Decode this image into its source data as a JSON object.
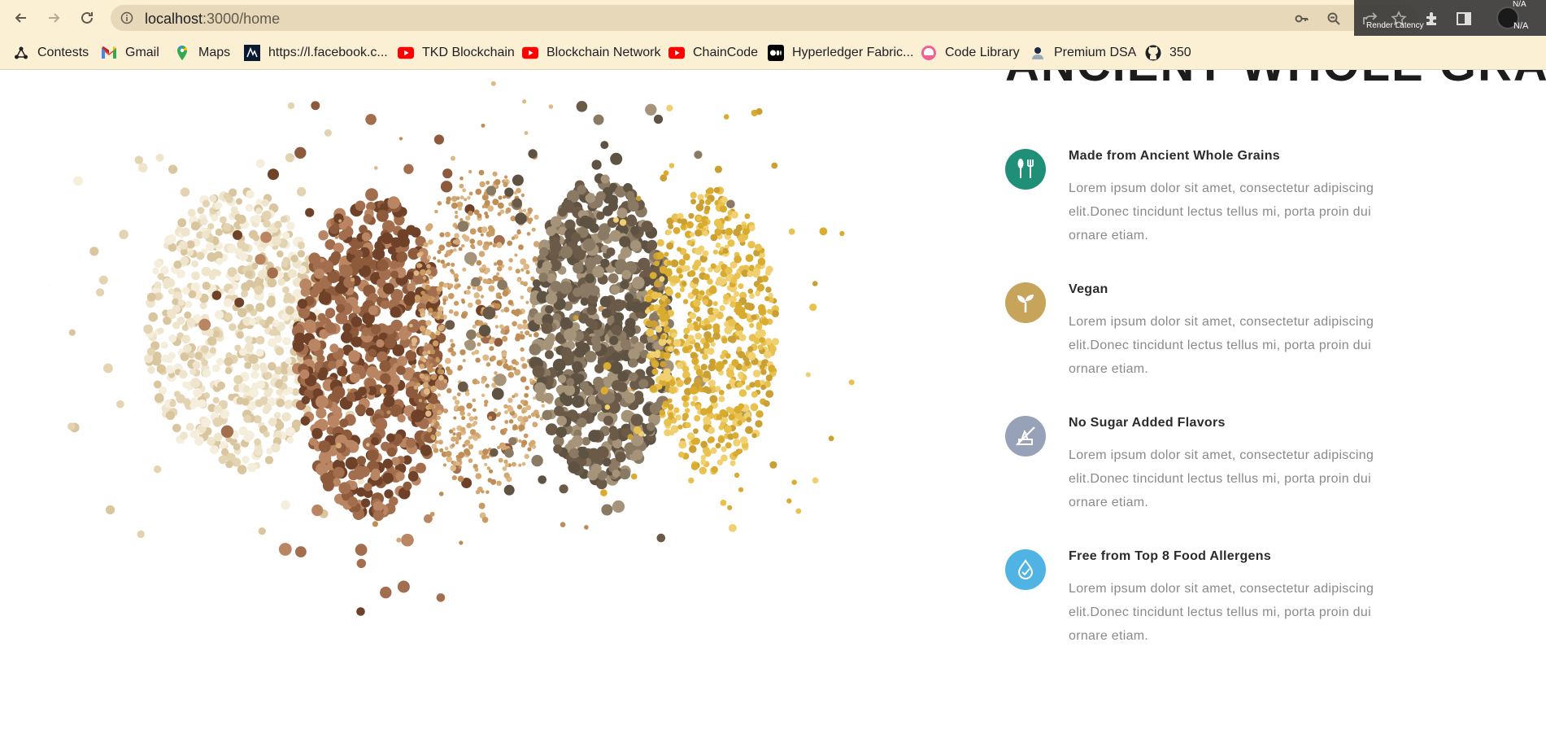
{
  "browser": {
    "url_host": "localhost",
    "url_path": ":3000/home",
    "render_latency": "Render Latency",
    "na_top": "N/A",
    "na_bottom": "N/A"
  },
  "bookmarks": [
    {
      "label": "Contests",
      "icon": "contests-icon"
    },
    {
      "label": "Gmail",
      "icon": "gmail-icon"
    },
    {
      "label": "Maps",
      "icon": "maps-icon"
    },
    {
      "label": "https://l.facebook.c...",
      "icon": "facebook-link-icon"
    },
    {
      "label": "TKD Blockchain",
      "icon": "youtube-icon"
    },
    {
      "label": "Blockchain Network",
      "icon": "youtube-icon"
    },
    {
      "label": "ChainCode",
      "icon": "youtube-icon"
    },
    {
      "label": "Hyperledger Fabric...",
      "icon": "medium-icon"
    },
    {
      "label": "Code Library",
      "icon": "code-library-icon"
    },
    {
      "label": "Premium DSA",
      "icon": "premium-dsa-icon"
    },
    {
      "label": "350",
      "icon": "github-icon"
    }
  ],
  "page": {
    "heading": "ANCIENT WHOLE GRAINS",
    "features": [
      {
        "title": "Made from Ancient Whole Grains",
        "body": "Lorem ipsum dolor sit amet, consectetur adipiscing elit.Donec tincidunt lectus tellus mi, porta proin dui ornare etiam.",
        "icon": "utensils-icon",
        "color": "#1f8f77"
      },
      {
        "title": "Vegan",
        "body": "Lorem ipsum dolor sit amet, consectetur adipiscing elit.Donec tincidunt lectus tellus mi, porta proin dui ornare etiam.",
        "icon": "sprout-icon",
        "color": "#c6a45a"
      },
      {
        "title": "No Sugar Added Flavors",
        "body": "Lorem ipsum dolor sit amet, consectetur adipiscing elit.Donec tincidunt lectus tellus mi, porta proin dui ornare etiam.",
        "icon": "no-sugar-icon",
        "color": "#97a1b7"
      },
      {
        "title": "Free from Top 8 Food Allergens",
        "body": "Lorem ipsum dolor sit amet, consectetur adipiscing elit.Donec tincidunt lectus tellus mi, porta proin dui ornare etiam.",
        "icon": "allergen-free-icon",
        "color": "#4fb3e3"
      }
    ]
  }
}
